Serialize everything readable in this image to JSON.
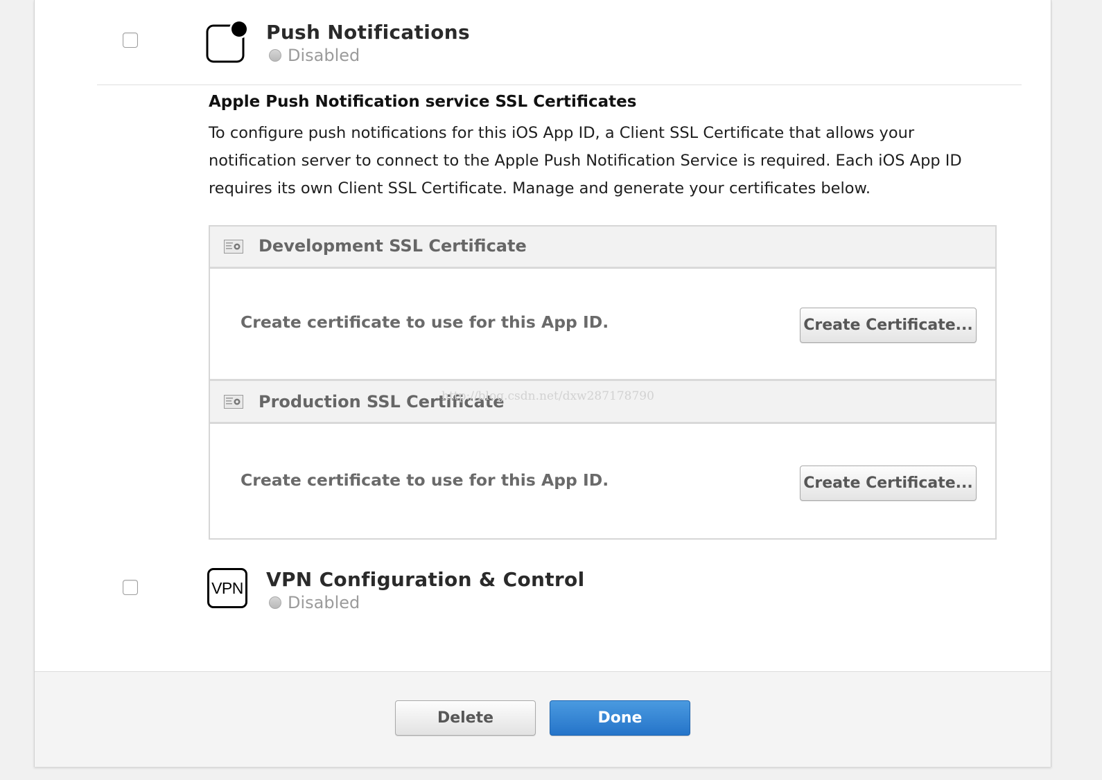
{
  "services": [
    {
      "name": "Push Notifications",
      "status": "Disabled",
      "icon": "push-notifications-icon",
      "checked": false
    },
    {
      "name": "VPN Configuration & Control",
      "status": "Disabled",
      "icon": "vpn-icon",
      "icon_text": "VPN",
      "checked": false
    }
  ],
  "apns": {
    "heading": "Apple Push Notification service SSL Certificates",
    "description": "To configure push notifications for this iOS App ID, a Client SSL Certificate that allows your notification server to connect to the Apple Push Notification Service is required. Each iOS App ID requires its own Client SSL Certificate. Manage and generate your certificates below.",
    "certificates": [
      {
        "title": "Development SSL Certificate",
        "text": "Create certificate to use for this App ID.",
        "button": "Create Certificate..."
      },
      {
        "title": "Production SSL Certificate",
        "text": "Create certificate to use for this App ID.",
        "button": "Create Certificate..."
      }
    ]
  },
  "watermark": "http://blog.csdn.net/dxw287178790",
  "footer": {
    "delete_label": "Delete",
    "done_label": "Done"
  },
  "colors": {
    "primary_button": "#2f80d6",
    "status_disabled": "#b9b9b9"
  }
}
